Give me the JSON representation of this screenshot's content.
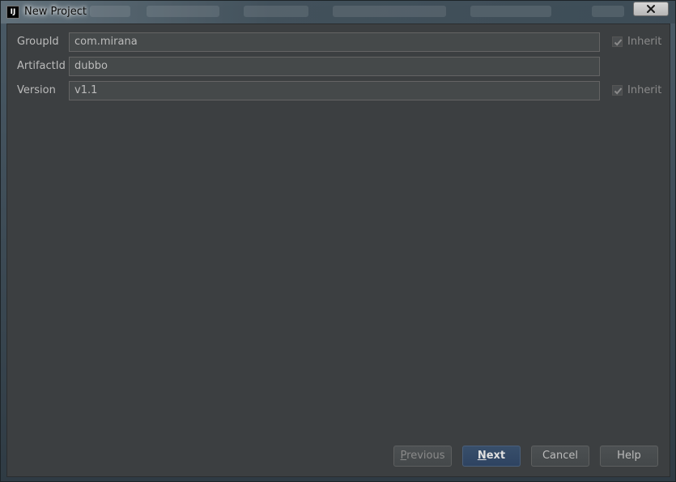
{
  "window": {
    "title": "New Project",
    "app_icon_text": "IJ"
  },
  "form": {
    "group_id": {
      "label": "GroupId",
      "value": "com.mirana",
      "inherit_label": "Inherit",
      "inherit_checked": true
    },
    "artifact_id": {
      "label": "ArtifactId",
      "value": "dubbo"
    },
    "version": {
      "label": "Version",
      "value": "v1.1",
      "inherit_label": "Inherit",
      "inherit_checked": true
    }
  },
  "buttons": {
    "previous_prefix": "",
    "previous_mnemonic": "P",
    "previous_rest": "revious",
    "next_mnemonic": "N",
    "next_rest": "ext",
    "cancel": "Cancel",
    "help": "Help"
  },
  "colors": {
    "background": "#3c3f41",
    "field_background": "#45494a",
    "primary_button": "#2e4361",
    "text": "#bbbbbb"
  },
  "icons": {
    "close": "close-icon",
    "check": "checkmark-icon",
    "app": "intellij-icon"
  }
}
